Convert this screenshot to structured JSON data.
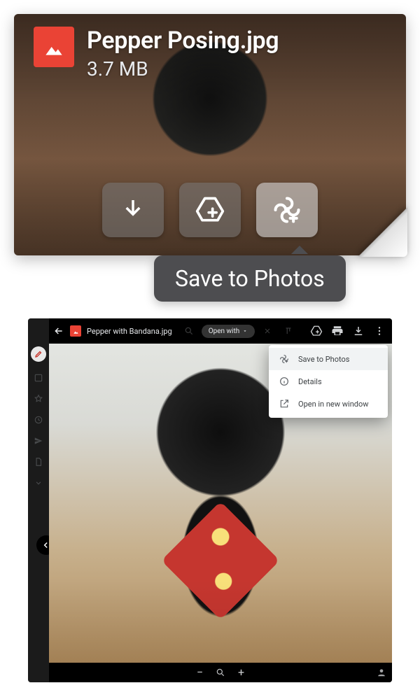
{
  "attachment": {
    "filename": "Pepper Posing.jpg",
    "size": "3.7 MB"
  },
  "tooltip": {
    "label": "Save to Photos"
  },
  "viewer": {
    "filename": "Pepper with Bandana.jpg",
    "open_with": "Open with",
    "menu": {
      "save_to_photos": "Save to Photos",
      "details": "Details",
      "open_new_window": "Open in new window"
    }
  }
}
